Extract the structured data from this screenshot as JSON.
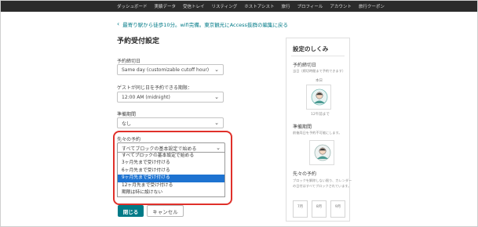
{
  "topnav": {
    "items": [
      "ダッシュボード",
      "実績データ",
      "受信トレイ",
      "リスティング",
      "ホストアシスト",
      "旅行",
      "プロフィール",
      "アカウント",
      "旅行クーポン"
    ]
  },
  "back_link": "最寄り駅から徒歩10分。wifi完備。東京観光にAccess抜群の編集に戻る",
  "page_title": "予約受付設定",
  "fields": {
    "cutoff_label": "予約締切日",
    "cutoff_value": "Same day (customizable cutoff hour)",
    "sameday_label": "ゲストが同じ日を予約できる期限：",
    "sameday_value": "12:00 AM (midnight)",
    "prep_label": "準備期間",
    "prep_value": "なし",
    "advance_label": "先々の予約",
    "advance_value": "すべてブロックの基本設定で始める"
  },
  "dropdown": {
    "options": [
      "すべてブロックの基本設定で始める",
      "3ヶ月先まで受け付ける",
      "6ヶ月先まで受け付ける",
      "9ヶ月先まで受け付ける",
      "12ヶ月先まで受け付ける",
      "期限は特に設けない"
    ],
    "selected_index": 3
  },
  "buttons": {
    "close": "閉じる",
    "cancel": "キャンセル"
  },
  "panel": {
    "title": "設定のしくみ",
    "cutoff_head": "予約締切日",
    "cutoff_sub": "当日（締切時間まで予約できます）",
    "today_label": "本日",
    "noon_label": "12午前まで",
    "prep_head": "準備期間",
    "prep_sub": "前後両日を予約不可能にします。",
    "advance_head": "先々の予約",
    "advance_sub1": "ブロックを解除しない限り、カレンダー",
    "advance_sub2": "の日付はすべてブロックされています。",
    "months": [
      "7月",
      "8月",
      "9月"
    ]
  },
  "colors": {
    "accent": "#007a87",
    "highlight": "#e0302a",
    "selected_option": "#1e73d1"
  }
}
